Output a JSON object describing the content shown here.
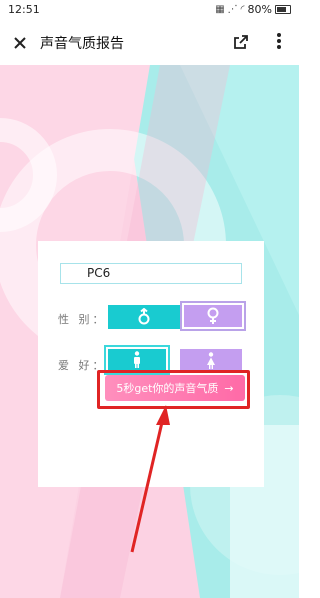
{
  "status_bar": {
    "time": "12:51",
    "battery_percent": "80%"
  },
  "app_bar": {
    "title": "声音气质报告"
  },
  "form": {
    "name_value": "PC6",
    "gender_label": "性 别：",
    "hobby_label": "爱 好：",
    "gender_options": [
      {
        "icon": "male-symbol-icon",
        "selected": false
      },
      {
        "icon": "female-symbol-icon",
        "selected": true
      }
    ],
    "hobby_options": [
      {
        "icon": "male-figure-icon",
        "selected": true
      },
      {
        "icon": "female-figure-icon",
        "selected": false
      }
    ],
    "cta_label": "5秒get你的声音气质",
    "cta_arrow": "→"
  },
  "colors": {
    "teal": "#19cbd0",
    "purple": "#c49ef0",
    "pink_cta": "#ff7ab0",
    "annotation_red": "#e02424"
  }
}
